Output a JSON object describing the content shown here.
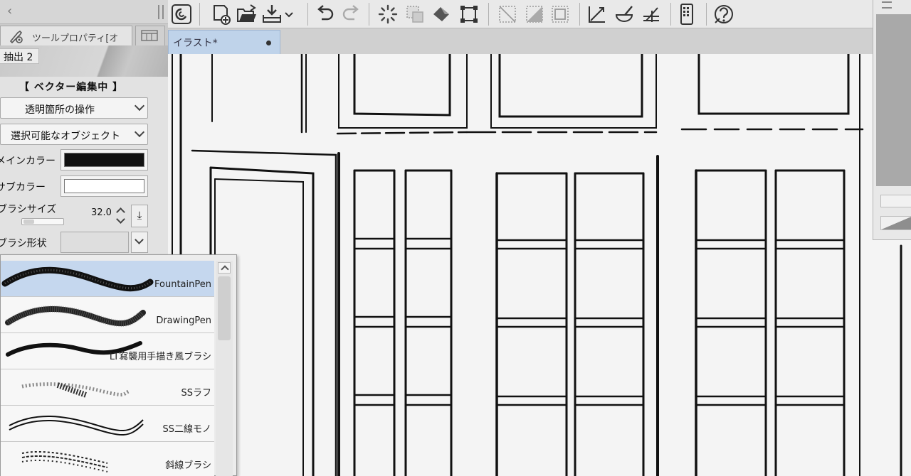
{
  "tool_property": {
    "tab_label": "ツールプロパティ[オ",
    "sub_tool_name": "抽出 2",
    "vector_status": "【 ベクター編集中 】",
    "transparent_op": "透明箇所の操作",
    "selectable_objects": "選択可能なオブジェクト",
    "main_color_label": "メインカラー",
    "sub_color_label": "サブカラー",
    "brush_size_label": "ブラシサイズ",
    "brush_size_value": "32.0",
    "brush_size_slider_fraction": 0.25,
    "brush_shape_label": "ブラシ形状",
    "main_color": "#111111",
    "sub_color": "#ffffff"
  },
  "brush_popup": {
    "items": [
      {
        "label": "FountainPen",
        "selected": true
      },
      {
        "label": "DrawingPen",
        "selected": false
      },
      {
        "label": "LT寫襲用手描き風ブラシ",
        "selected": false
      },
      {
        "label": "SSラフ",
        "selected": false
      },
      {
        "label": "SS二線モノ",
        "selected": false
      },
      {
        "label": "斜線ブラシ",
        "selected": false
      }
    ]
  },
  "toolbar": {
    "icons": [
      "clip-studio-icon",
      "new-canvas-icon",
      "open-folder-icon",
      "save-icon",
      "dropdown-chevron-icon",
      "undo-icon",
      "redo-icon",
      "loading-icon",
      "clear-selection-icon",
      "fill-icon",
      "transform-icon",
      "deselect-icon",
      "invert-selection-icon",
      "selection-border-icon",
      "ruler-icon",
      "ink-icon",
      "perspective-icon",
      "smartphone-icon",
      "help-icon"
    ]
  },
  "canvas": {
    "tab_title": "イラスト*"
  },
  "colors": {
    "selection_highlight": "#c5d7ee",
    "tab_active": "#bfd3ea",
    "canvas_bg": "#f4f4f4"
  }
}
